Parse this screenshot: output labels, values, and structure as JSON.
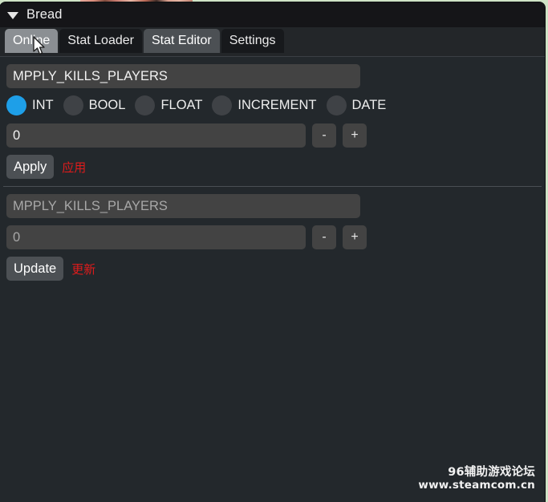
{
  "window": {
    "title": "Bread",
    "collapse_icon": "triangle-down-icon"
  },
  "tabs": [
    {
      "label": "Online",
      "state": "selected"
    },
    {
      "label": "Stat Loader",
      "state": "normal"
    },
    {
      "label": "Stat Editor",
      "state": "semi"
    },
    {
      "label": "Settings",
      "state": "normal"
    }
  ],
  "apply_section": {
    "stat_name": {
      "value": "MPPLY_KILLS_PLAYERS",
      "placeholder": "MPPLY_KILLS_PLAYERS"
    },
    "types": [
      {
        "label": "INT",
        "selected": true
      },
      {
        "label": "BOOL",
        "selected": false
      },
      {
        "label": "FLOAT",
        "selected": false
      },
      {
        "label": "INCREMENT",
        "selected": false
      },
      {
        "label": "DATE",
        "selected": false
      }
    ],
    "stat_value": {
      "value": "0",
      "placeholder": "0"
    },
    "decrement_label": "-",
    "increment_label": "+",
    "apply_label": "Apply",
    "apply_hint": "应用"
  },
  "update_section": {
    "stat_name": {
      "value": "",
      "placeholder": "MPPLY_KILLS_PLAYERS"
    },
    "stat_value": {
      "value": "",
      "placeholder": "0"
    },
    "decrement_label": "-",
    "increment_label": "+",
    "update_label": "Update",
    "update_hint": "更新"
  },
  "watermark": {
    "line1": "96辅助游戏论坛",
    "line2": "www.steamcom.cn"
  },
  "colors": {
    "window_bg": "#23282c",
    "titlebar_bg": "#151518",
    "input_bg": "#434343",
    "tab_selected_bg": "#8b8f93",
    "tab_semi_bg": "#4c5054",
    "tab_bg": "#17191c",
    "accent_radio": "#1e9fe8",
    "hint_red": "#e01b1b",
    "desktop_bg": "#cfe3c6"
  }
}
